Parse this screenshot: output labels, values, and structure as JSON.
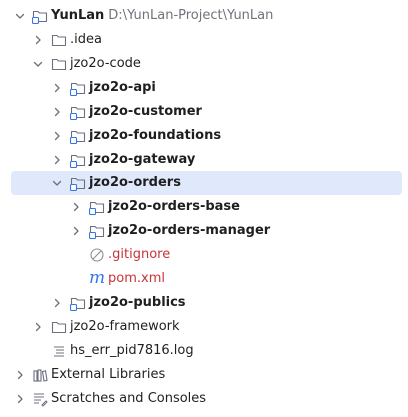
{
  "project_tree": {
    "root": {
      "label": "YunLan",
      "path": "D:\\YunLan-Project\\YunLan",
      "icon": "module-folder-icon",
      "expanded": true
    },
    "items": [
      {
        "label": ".idea",
        "icon": "folder-icon",
        "expanded": false
      },
      {
        "label": "jzo2o-code",
        "icon": "folder-icon",
        "expanded": true
      },
      {
        "label": "jzo2o-api",
        "icon": "module-folder-icon",
        "expanded": false
      },
      {
        "label": "jzo2o-customer",
        "icon": "module-folder-icon",
        "expanded": false
      },
      {
        "label": "jzo2o-foundations",
        "icon": "module-folder-icon",
        "expanded": false
      },
      {
        "label": "jzo2o-gateway",
        "icon": "module-folder-icon",
        "expanded": false
      },
      {
        "label": "jzo2o-orders",
        "icon": "module-folder-icon",
        "expanded": true,
        "selected": true
      },
      {
        "label": "jzo2o-orders-base",
        "icon": "module-folder-icon",
        "expanded": false
      },
      {
        "label": "jzo2o-orders-manager",
        "icon": "module-folder-icon",
        "expanded": false
      },
      {
        "label": ".gitignore",
        "icon": "ignored-file-icon"
      },
      {
        "label": "pom.xml",
        "icon": "maven-icon"
      },
      {
        "label": "jzo2o-publics",
        "icon": "module-folder-icon",
        "expanded": false
      },
      {
        "label": "jzo2o-framework",
        "icon": "folder-icon",
        "expanded": false
      },
      {
        "label": "hs_err_pid7816.log",
        "icon": "log-file-icon"
      },
      {
        "label": "External Libraries",
        "icon": "libraries-icon",
        "expanded": false
      },
      {
        "label": "Scratches and Consoles",
        "icon": "scratches-icon",
        "expanded": false
      }
    ]
  },
  "colors": {
    "selection": "#dfe9fb",
    "icon_stroke": "#6c707e",
    "module_dot": "#3574f0",
    "ignored_text": "#c7343b",
    "maven": "#3574f0",
    "path_text": "#6f737a"
  }
}
